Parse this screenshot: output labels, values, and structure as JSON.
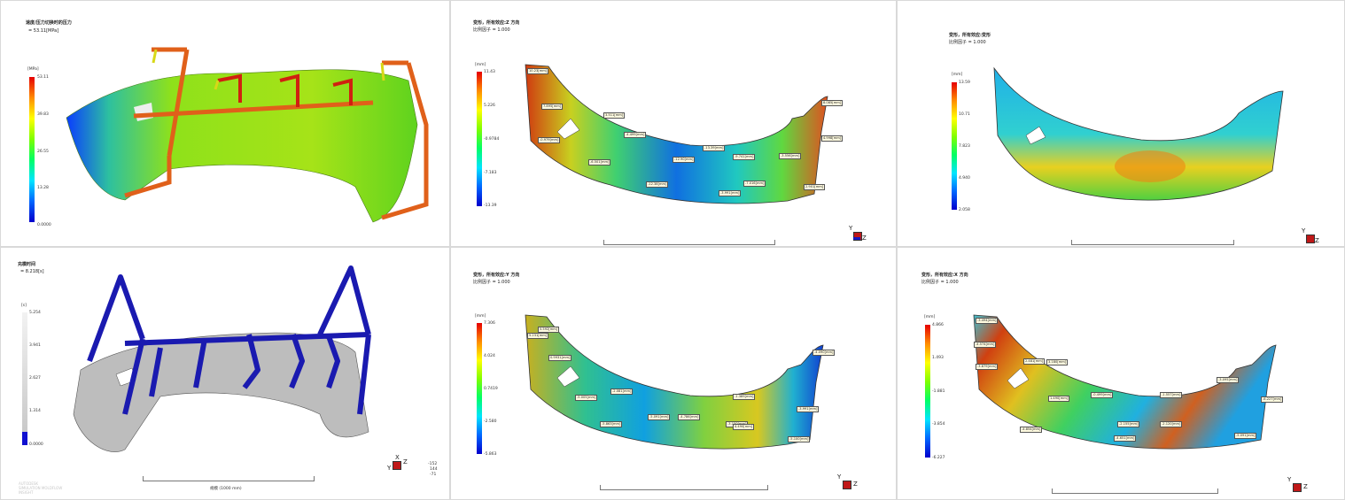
{
  "panels": [
    {
      "id": "pressure",
      "title": "速度/压力切换时的压力",
      "subtitle": "= 53.11[MPa]",
      "unit": "[MPa]",
      "ticks": [
        "53.11",
        "39.83",
        "26.55",
        "13.28",
        "0.0000"
      ],
      "colorbar": "rainbow"
    },
    {
      "id": "defl-z",
      "title": "变形，所有效应:Z 方向",
      "subtitle": "比例因子 = 1.000",
      "unit": "[mm]",
      "ticks": [
        "11.43",
        "5.226",
        "-0.9784",
        "-7.183",
        "-13.39"
      ],
      "colorbar": "rainbow",
      "callouts": [
        "10.23[mm]",
        "7.895[mm]",
        "3.511[mm]",
        "-0.979[mm]",
        "-4.499[mm]",
        "-6.501[mm]",
        "-12.90[mm]",
        "-13.39[mm]",
        "-12.38[mm]",
        "-9.741[mm]",
        "-7.016[mm]",
        "-3.991[mm]",
        "-3.556[mm]",
        "8.085[mm]",
        "4.998[mm]",
        "2.901[mm]"
      ]
    },
    {
      "id": "defl-all",
      "title": "变形，所有效应:变形",
      "subtitle": "比例因子 = 1.000",
      "unit": "[mm]",
      "ticks": [
        "13.59",
        "10.71",
        "7.823",
        "4.940",
        "2.058"
      ],
      "colorbar": "rainbow"
    },
    {
      "id": "freeze",
      "title": "充模时间",
      "subtitle": "= 8.218[s]",
      "unit": "[s]",
      "ticks": [
        "5.254",
        "3.941",
        "2.627",
        "1.314",
        "0.0000"
      ],
      "colorbar": "gray",
      "coords": [
        "-152",
        "144",
        "-71"
      ],
      "scale_label": "规模 (1000 mm)",
      "faint": "AUTODESK\nSIMULATION MOLDFLOW\nINSIGHT"
    },
    {
      "id": "defl-y",
      "title": "变形，所有效应:Y 方向",
      "subtitle": "比例因子 = 1.000",
      "unit": "[mm]",
      "ticks": [
        "7.306",
        "4.024",
        "0.7419",
        "-2.580",
        "-5.863"
      ],
      "colorbar": "rainbow",
      "callouts": [
        "5.592[mm]",
        "5.231[mm]",
        "0.9931[mm]",
        "-2.081[mm]",
        "-5.005[mm]",
        "-5.091[mm]",
        "-5.863[mm]",
        "-4.786[mm]",
        "-3.150[mm]",
        "4.490[mm]",
        "-1.389[mm]",
        "-3.991[mm]",
        "-5.100[mm]",
        "-4.090[mm]"
      ]
    },
    {
      "id": "defl-x",
      "title": "变形，所有效应:X 方向",
      "subtitle": "比例因子 = 1.000",
      "unit": "[mm]",
      "ticks": [
        "4.866",
        "1.493",
        "-1.881",
        "-3.854",
        "-6.227"
      ],
      "colorbar": "rainbow",
      "callouts": [
        "-3.494[mm]",
        "-4.574[mm]",
        "-3.879[mm]",
        "2.481[mm]",
        "3.180[mm]",
        "1.490[mm]",
        "-0.499[mm]",
        "-1.557[mm]",
        "-3.095[mm]",
        "-2.155[mm]",
        "-2.120[mm]",
        "-4.854[mm]",
        "-4.651[mm]",
        "-5.091[mm]",
        "-6.227[mm]"
      ]
    }
  ],
  "triad": {
    "x": "X",
    "y": "Y",
    "z": "Z"
  },
  "colors": {
    "panel_border": "#d9d9d9",
    "frame_blue": "#1a1ab0",
    "frame_orange": "#e07020",
    "part_gray": "#a8a8a8"
  }
}
